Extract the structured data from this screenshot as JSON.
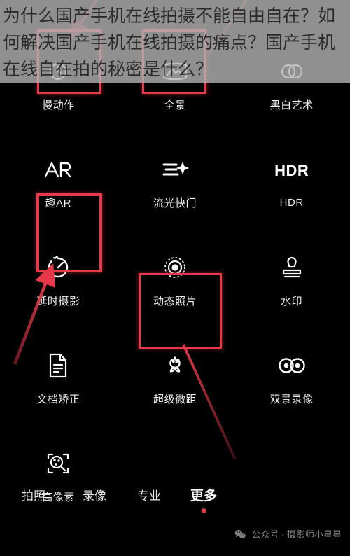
{
  "overlay": {
    "text": "为什么国产手机在线拍摄不能自由自在？如何解决国产手机在线拍摄的痛点？国产手机在线自在拍的秘密是什么？",
    "background_color": "#b4b4b4",
    "text_color": "#2b2b2b"
  },
  "accent_color": "#e8394a",
  "camera": {
    "modes": [
      {
        "label": "慢动作",
        "icon": "slow-motion-icon",
        "highlighted": true
      },
      {
        "label": "全景",
        "icon": "panorama-icon",
        "highlighted": true
      },
      {
        "label": "黑白艺术",
        "icon": "black-white-art-icon",
        "highlighted": false
      },
      {
        "label": "趣AR",
        "icon": "ar-icon",
        "highlighted": false
      },
      {
        "label": "流光快门",
        "icon": "light-painting-icon",
        "highlighted": false
      },
      {
        "label": "HDR",
        "icon": "hdr-icon",
        "highlighted": false
      },
      {
        "label": "延时摄影",
        "icon": "time-lapse-icon",
        "highlighted": true
      },
      {
        "label": "动态照片",
        "icon": "live-photo-icon",
        "highlighted": false
      },
      {
        "label": "水印",
        "icon": "watermark-stamp-icon",
        "highlighted": false
      },
      {
        "label": "文档矫正",
        "icon": "document-icon",
        "highlighted": false
      },
      {
        "label": "超级微距",
        "icon": "macro-flower-icon",
        "highlighted": true
      },
      {
        "label": "双景录像",
        "icon": "dual-view-icon",
        "highlighted": false
      },
      {
        "label": "高像素",
        "icon": "high-pixel-icon",
        "highlighted": false
      }
    ],
    "hdr_glyph": "HDR"
  },
  "bottom_nav": {
    "items": [
      {
        "label": "拍照",
        "active": false
      },
      {
        "label": "录像",
        "active": false
      },
      {
        "label": "专业",
        "active": false
      },
      {
        "label": "更多",
        "active": true
      }
    ]
  },
  "footer": {
    "watermark": "公众号 · 摄影师小星星",
    "icon": "wechat-icon"
  }
}
